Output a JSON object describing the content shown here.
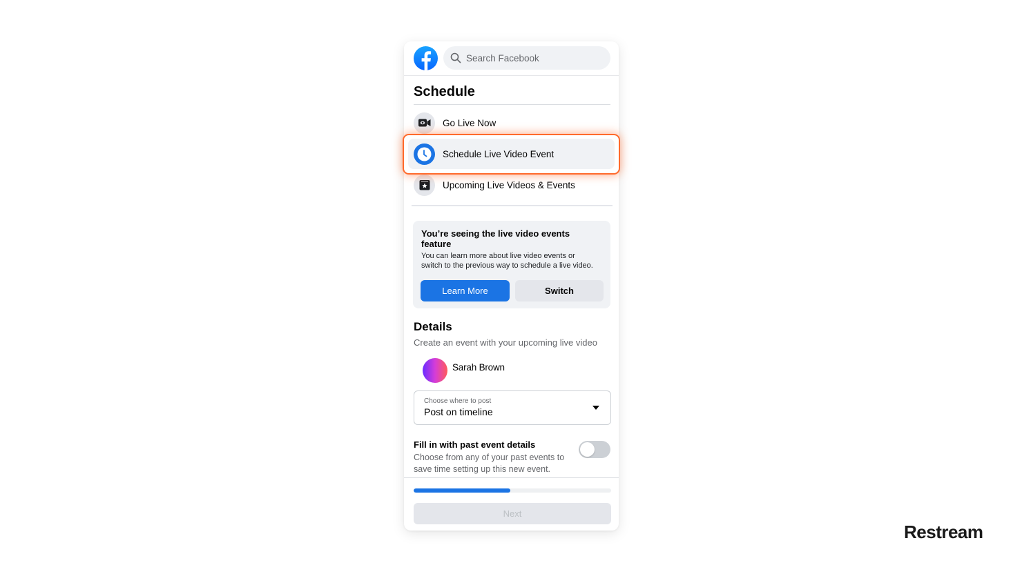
{
  "header": {
    "logo": "facebook-logo",
    "search": {
      "placeholder": "Search Facebook",
      "value": "",
      "icon": "search-icon"
    }
  },
  "schedule": {
    "title": "Schedule",
    "menu": [
      {
        "label": "Go Live Now",
        "icon": "video-camera-icon",
        "selected": false
      },
      {
        "label": "Schedule Live Video Event",
        "icon": "clock-icon",
        "selected": true
      },
      {
        "label": "Upcoming Live Videos & Events",
        "icon": "calendar-star-icon",
        "selected": false
      }
    ]
  },
  "notice": {
    "title": "You’re seeing the live video events feature",
    "body": "You can learn more about live video events or switch to the previous way to schedule a live video.",
    "learn_more_label": "Learn More",
    "switch_label": "Switch"
  },
  "details": {
    "title": "Details",
    "subtitle": "Create an event with your upcoming live video",
    "user_name": "Sarah Brown",
    "post_select": {
      "label": "Choose where to post",
      "value": "Post on timeline"
    },
    "fill_past": {
      "title": "Fill in with past event details",
      "description": "Choose from any of your past events to save time setting up this new event.",
      "enabled": false
    }
  },
  "footer": {
    "progress_percent": 49,
    "next_label": "Next",
    "next_disabled": true
  },
  "branding": {
    "watermark": "Restream"
  },
  "colors": {
    "accent": "#1b74e4",
    "highlight": "#ff6a2b"
  }
}
